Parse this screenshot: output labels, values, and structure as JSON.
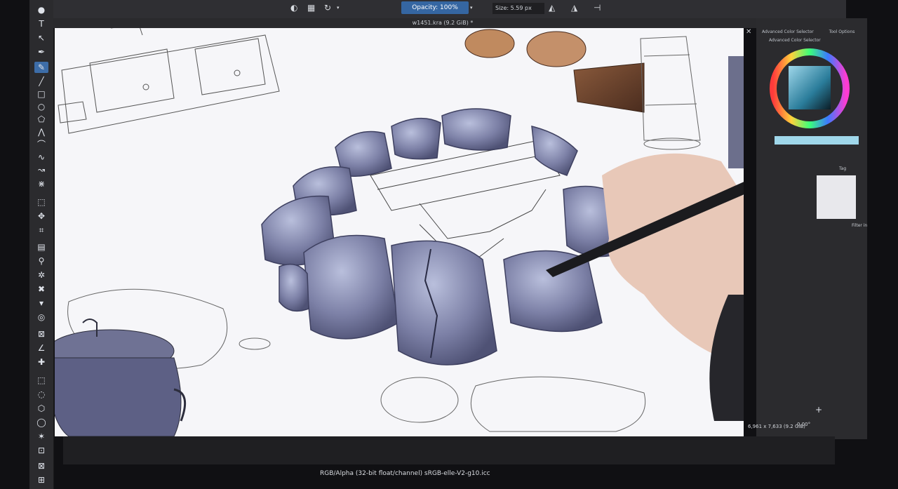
{
  "toolbar": {
    "opacity": "Opacity: 100%",
    "size": "Size: 5.59 px"
  },
  "document": {
    "title": "w1451.kra (9.2 GiB) *"
  },
  "panel": {
    "tab_color": "Advanced Color Selector",
    "tab_tool": "Tool Options",
    "sub_label": "Advanced Color Selector",
    "tag_label": "Tag",
    "filter_label": "Filter in"
  },
  "status": {
    "color_space": "RGB/Alpha (32-bit float/channel)  sRGB-elle-V2-g10.icc",
    "dimensions": "6,961 x 7,633 (9.2 GiB)",
    "rotation": "0.00°"
  },
  "colors": {
    "accent": "#3566a2",
    "ui_dark": "#2b2b2e",
    "canvas": "#f6f6f9",
    "rock_fill": "#6b6f95",
    "rock_highlight": "#b9bfdc"
  },
  "icons": [
    "brush-tool-icon",
    "text-tool-icon",
    "select-tool-icon",
    "rectangle-tool-icon",
    "ellipse-tool-icon",
    "crop-tool-icon",
    "move-tool-icon",
    "fill-tool-icon",
    "eyedropper-tool-icon",
    "zoom-tool-icon",
    "mirror-icon",
    "wrap-icon"
  ]
}
